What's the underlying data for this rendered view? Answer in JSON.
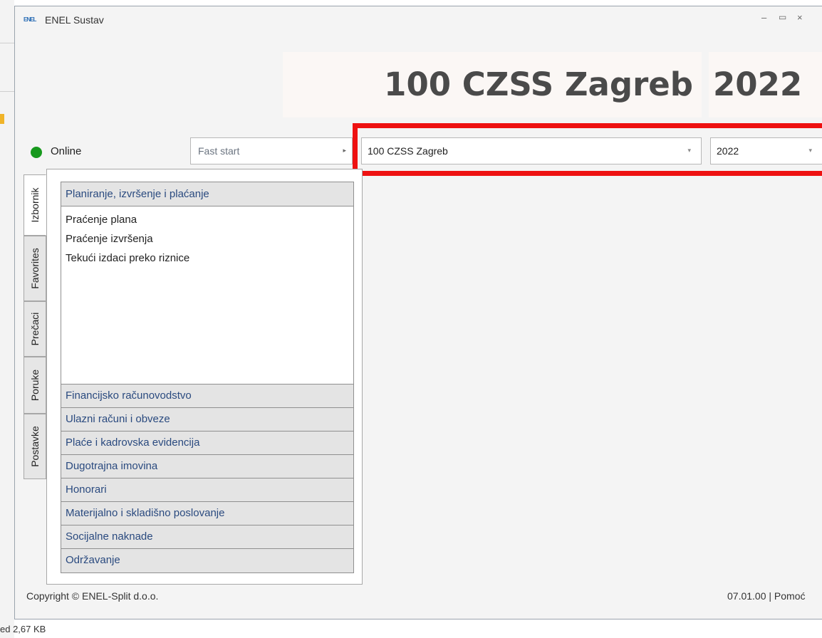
{
  "window": {
    "app_icon": "ENEL logo",
    "title": "ENEL Sustav",
    "minimize": "–",
    "maximize": "▭",
    "close": "×"
  },
  "header": {
    "organization": "100 CZSS Zagreb",
    "year": "2022"
  },
  "status": {
    "label": "Online",
    "color": "#17991d"
  },
  "fast_start": {
    "value": "Fast start",
    "arrow": "▸"
  },
  "selectors": {
    "organization": "100 CZSS Zagreb",
    "year": "2022",
    "dropdown_arrow": "▾",
    "highlight_color": "#ee1111"
  },
  "tabs": [
    {
      "label": "Izbornik",
      "active": true
    },
    {
      "label": "Favorites",
      "active": false
    },
    {
      "label": "Prečaci",
      "active": false
    },
    {
      "label": "Poruke",
      "active": false
    },
    {
      "label": "Postavke",
      "active": false
    }
  ],
  "menu": {
    "expanded_section": "Planiranje, izvršenje i plaćanje",
    "items": [
      "Praćenje plana",
      "Praćenje izvršenja",
      "Tekući izdaci preko riznice"
    ],
    "sections": [
      "Financijsko računovodstvo",
      "Ulazni računi i obveze",
      "Plaće i kadrovska evidencija",
      "Dugotrajna imovina",
      "Honorari",
      "Materijalno i skladišno poslovanje",
      "Socijalne naknade",
      "Održavanje"
    ]
  },
  "footer": {
    "copyright": "Copyright © ENEL-Split d.o.o.",
    "version": "07.01.00 | Pomoć"
  },
  "background_text": "ed  2,67 KB"
}
